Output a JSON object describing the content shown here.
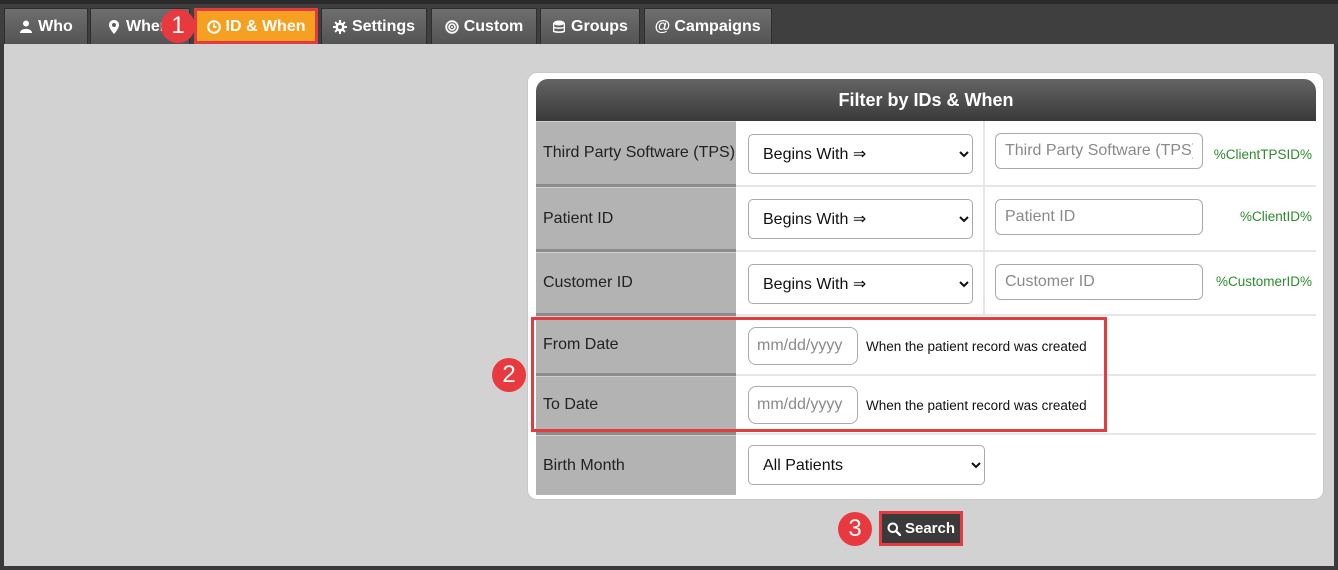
{
  "tabs": [
    {
      "label": "Who",
      "icon": "user-icon"
    },
    {
      "label": "Where",
      "icon": "map-marker-icon"
    },
    {
      "label": "ID & When",
      "icon": "clock-icon",
      "active": true
    },
    {
      "label": "Settings",
      "icon": "gear-icon"
    },
    {
      "label": "Custom",
      "icon": "target-icon"
    },
    {
      "label": "Groups",
      "icon": "groups-icon"
    },
    {
      "label": "Campaigns",
      "icon": "at-icon"
    }
  ],
  "panel": {
    "title": "Filter by IDs & When",
    "rows": [
      {
        "label": "Third Party Software (TPS)",
        "match": "Begins With ⇒",
        "placeholder": "Third Party Software (TPS)",
        "variable": "%ClientTPSID%"
      },
      {
        "label": "Patient ID",
        "match": "Begins With ⇒",
        "placeholder": "Patient ID",
        "variable": "%ClientID%"
      },
      {
        "label": "Customer ID",
        "match": "Begins With ⇒",
        "placeholder": "Customer ID",
        "variable": "%CustomerID%"
      }
    ],
    "dates": [
      {
        "label": "From Date",
        "placeholder": "mm/dd/yyyy",
        "help": "When the patient record was created"
      },
      {
        "label": "To Date",
        "placeholder": "mm/dd/yyyy",
        "help": "When the patient record was created"
      }
    ],
    "birth_month": {
      "label": "Birth Month",
      "value": "All Patients"
    }
  },
  "search": {
    "label": "Search"
  },
  "callouts": [
    "1",
    "2",
    "3"
  ],
  "colors": {
    "accent_tab": "#f5a021",
    "callout": "#e8393f",
    "variable_text": "#2e8b2e"
  }
}
